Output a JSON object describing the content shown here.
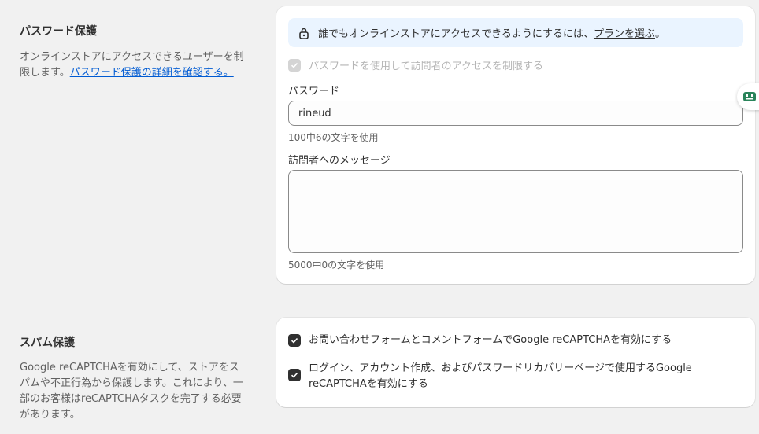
{
  "password_section": {
    "title": "パスワード保護",
    "desc_text": "オンラインストアにアクセスできるユーザーを制限します。",
    "desc_link": "パスワード保護の詳細を確認する。",
    "banner_text": "誰でもオンラインストアにアクセスできるようにするには、",
    "banner_link": "プランを選ぶ",
    "banner_suffix": "。",
    "restrict_checkbox_label": "パスワードを使用して訪問者のアクセスを制限する",
    "password_label": "パスワード",
    "password_value": "rineud",
    "password_count": "100中6の文字を使用",
    "message_label": "訪問者へのメッセージ",
    "message_value": "",
    "message_count": "5000中0の文字を使用"
  },
  "spam_section": {
    "title": "スパム保護",
    "desc": "Google reCAPTCHAを有効にして、ストアをスパムや不正行為から保護します。これにより、一部のお客様はreCAPTCHAタスクを完了する必要があります。",
    "checkbox1_label": "お問い合わせフォームとコメントフォームでGoogle reCAPTCHAを有効にする",
    "checkbox2_label": "ログイン、アカウント作成、およびパスワードリカバリーページで使用するGoogle reCAPTCHAを有効にする"
  },
  "colors": {
    "link": "#005bd3",
    "banner_bg": "#eaf4ff",
    "checkbox_checked": "#303030",
    "widget_icon": "#29845a"
  },
  "icons": [
    "lock-icon",
    "checkmark-icon",
    "assistant-robot-icon"
  ]
}
